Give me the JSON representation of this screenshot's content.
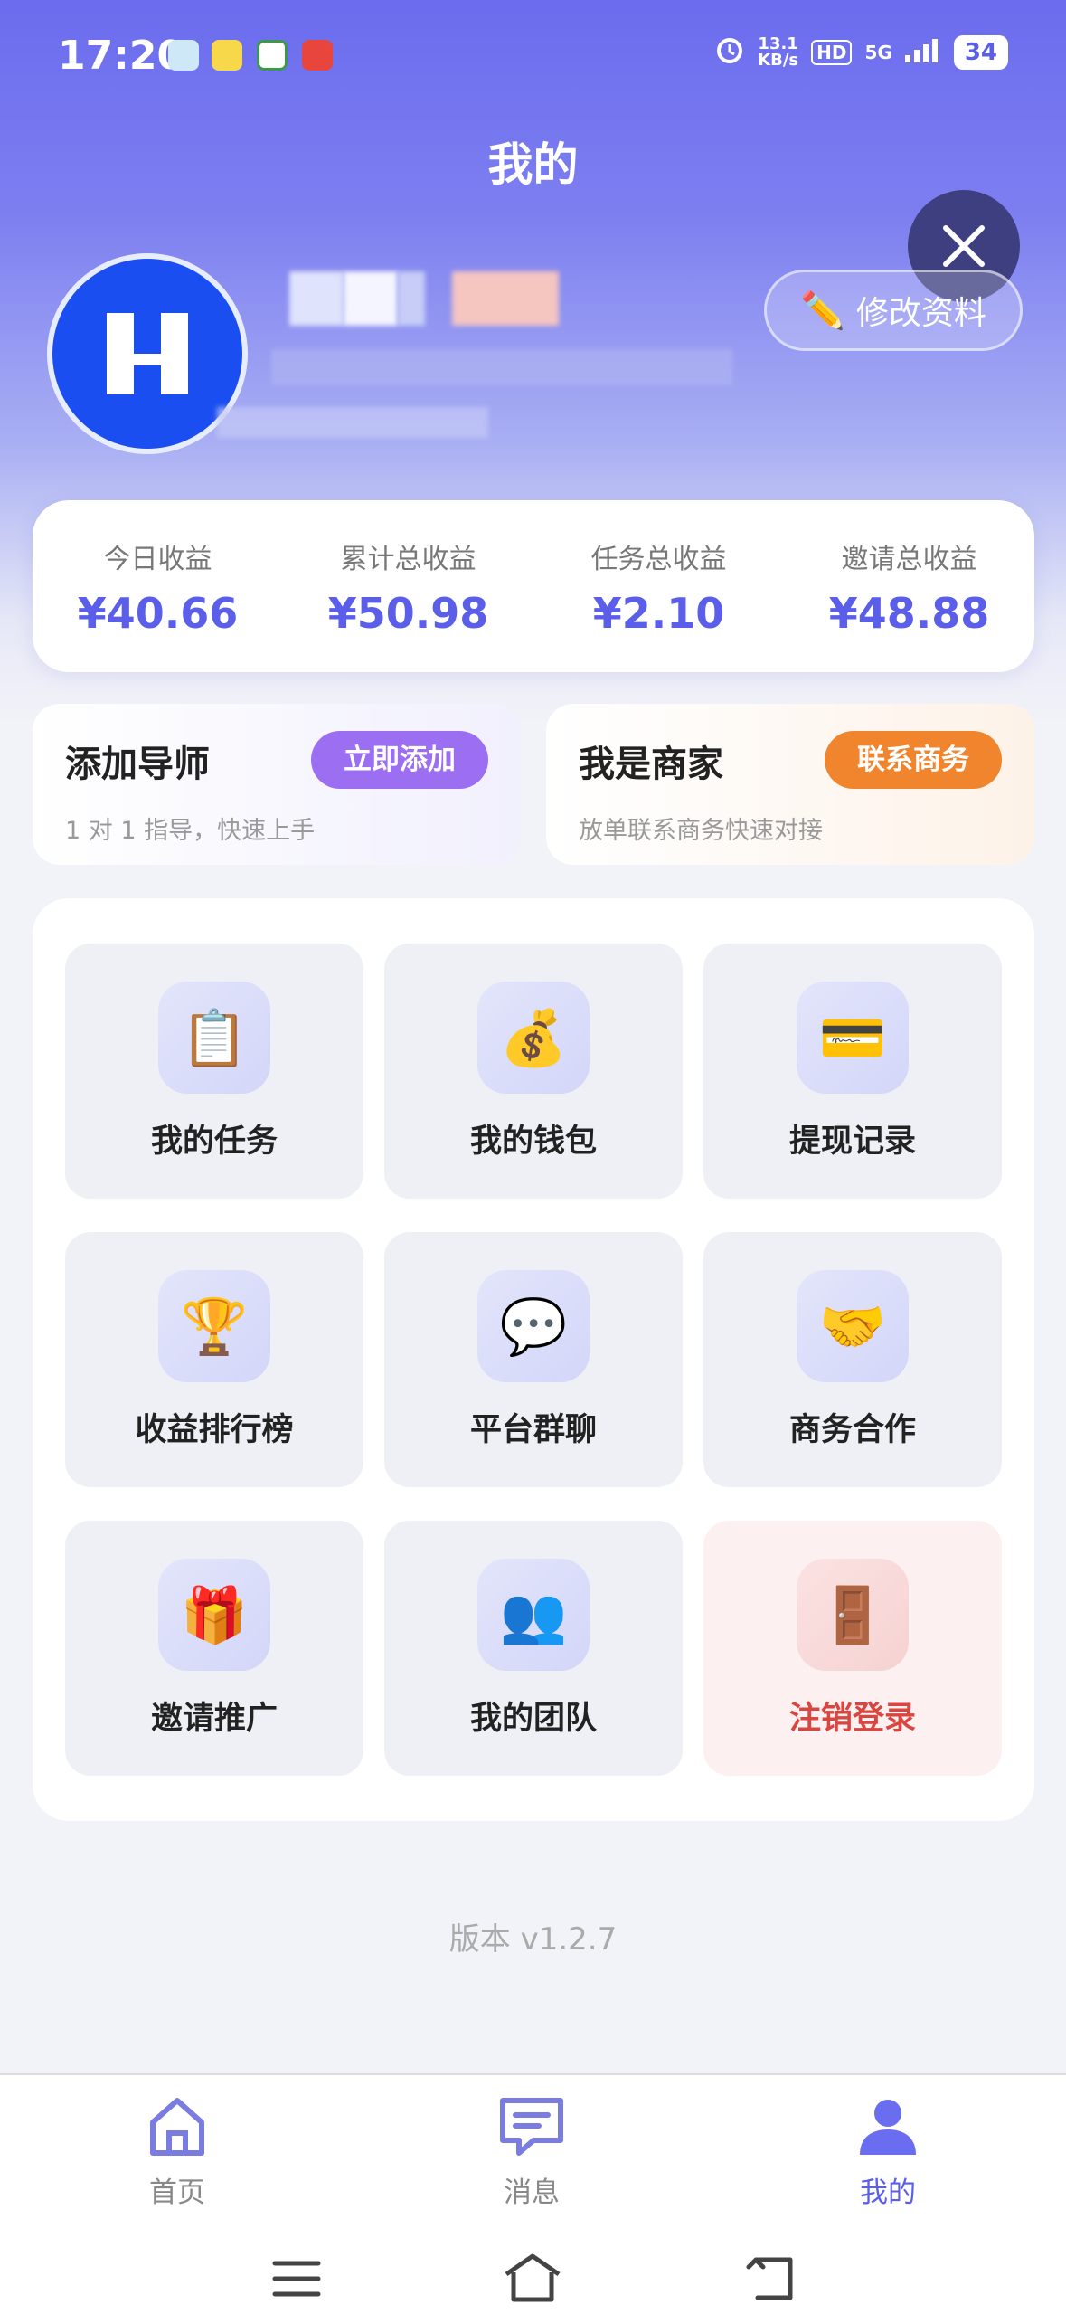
{
  "status_bar": {
    "time": "17:20",
    "net_speed": "13.1\nKB/s",
    "hd": "HD",
    "network": "5G",
    "battery": "34"
  },
  "header": {
    "title": "我的"
  },
  "profile": {
    "edit_label": "修改资料"
  },
  "stats": [
    {
      "label": "今日收益",
      "value": "¥40.66"
    },
    {
      "label": "累计总收益",
      "value": "¥50.98"
    },
    {
      "label": "任务总收益",
      "value": "¥2.10"
    },
    {
      "label": "邀请总收益",
      "value": "¥48.88"
    }
  ],
  "promo": {
    "mentor": {
      "title": "添加导师",
      "subtitle": "1 对 1 指导，快速上手",
      "button": "立即添加"
    },
    "merchant": {
      "title": "我是商家",
      "subtitle": "放单联系商务快速对接",
      "button": "联系商务"
    }
  },
  "menu": [
    {
      "label": "我的任务",
      "icon": "clipboard-icon",
      "glyph": "📋"
    },
    {
      "label": "我的钱包",
      "icon": "money-bag-icon",
      "glyph": "💰"
    },
    {
      "label": "提现记录",
      "icon": "credit-card-icon",
      "glyph": "💳"
    },
    {
      "label": "收益排行榜",
      "icon": "trophy-icon",
      "glyph": "🏆"
    },
    {
      "label": "平台群聊",
      "icon": "chat-bubble-icon",
      "glyph": "💬"
    },
    {
      "label": "商务合作",
      "icon": "handshake-icon",
      "glyph": "🤝"
    },
    {
      "label": "邀请推广",
      "icon": "gift-icon",
      "glyph": "🎁"
    },
    {
      "label": "我的团队",
      "icon": "team-icon",
      "glyph": "👥"
    },
    {
      "label": "注销登录",
      "icon": "door-icon",
      "glyph": "🚪"
    }
  ],
  "version": "版本 v1.2.7",
  "tabbar": {
    "home": "首页",
    "messages": "消息",
    "mine": "我的"
  },
  "colors": {
    "accent": "#5b5ee8",
    "orange": "#f1852d",
    "purple_button": "#9b6ef2",
    "danger": "#d9453f"
  }
}
